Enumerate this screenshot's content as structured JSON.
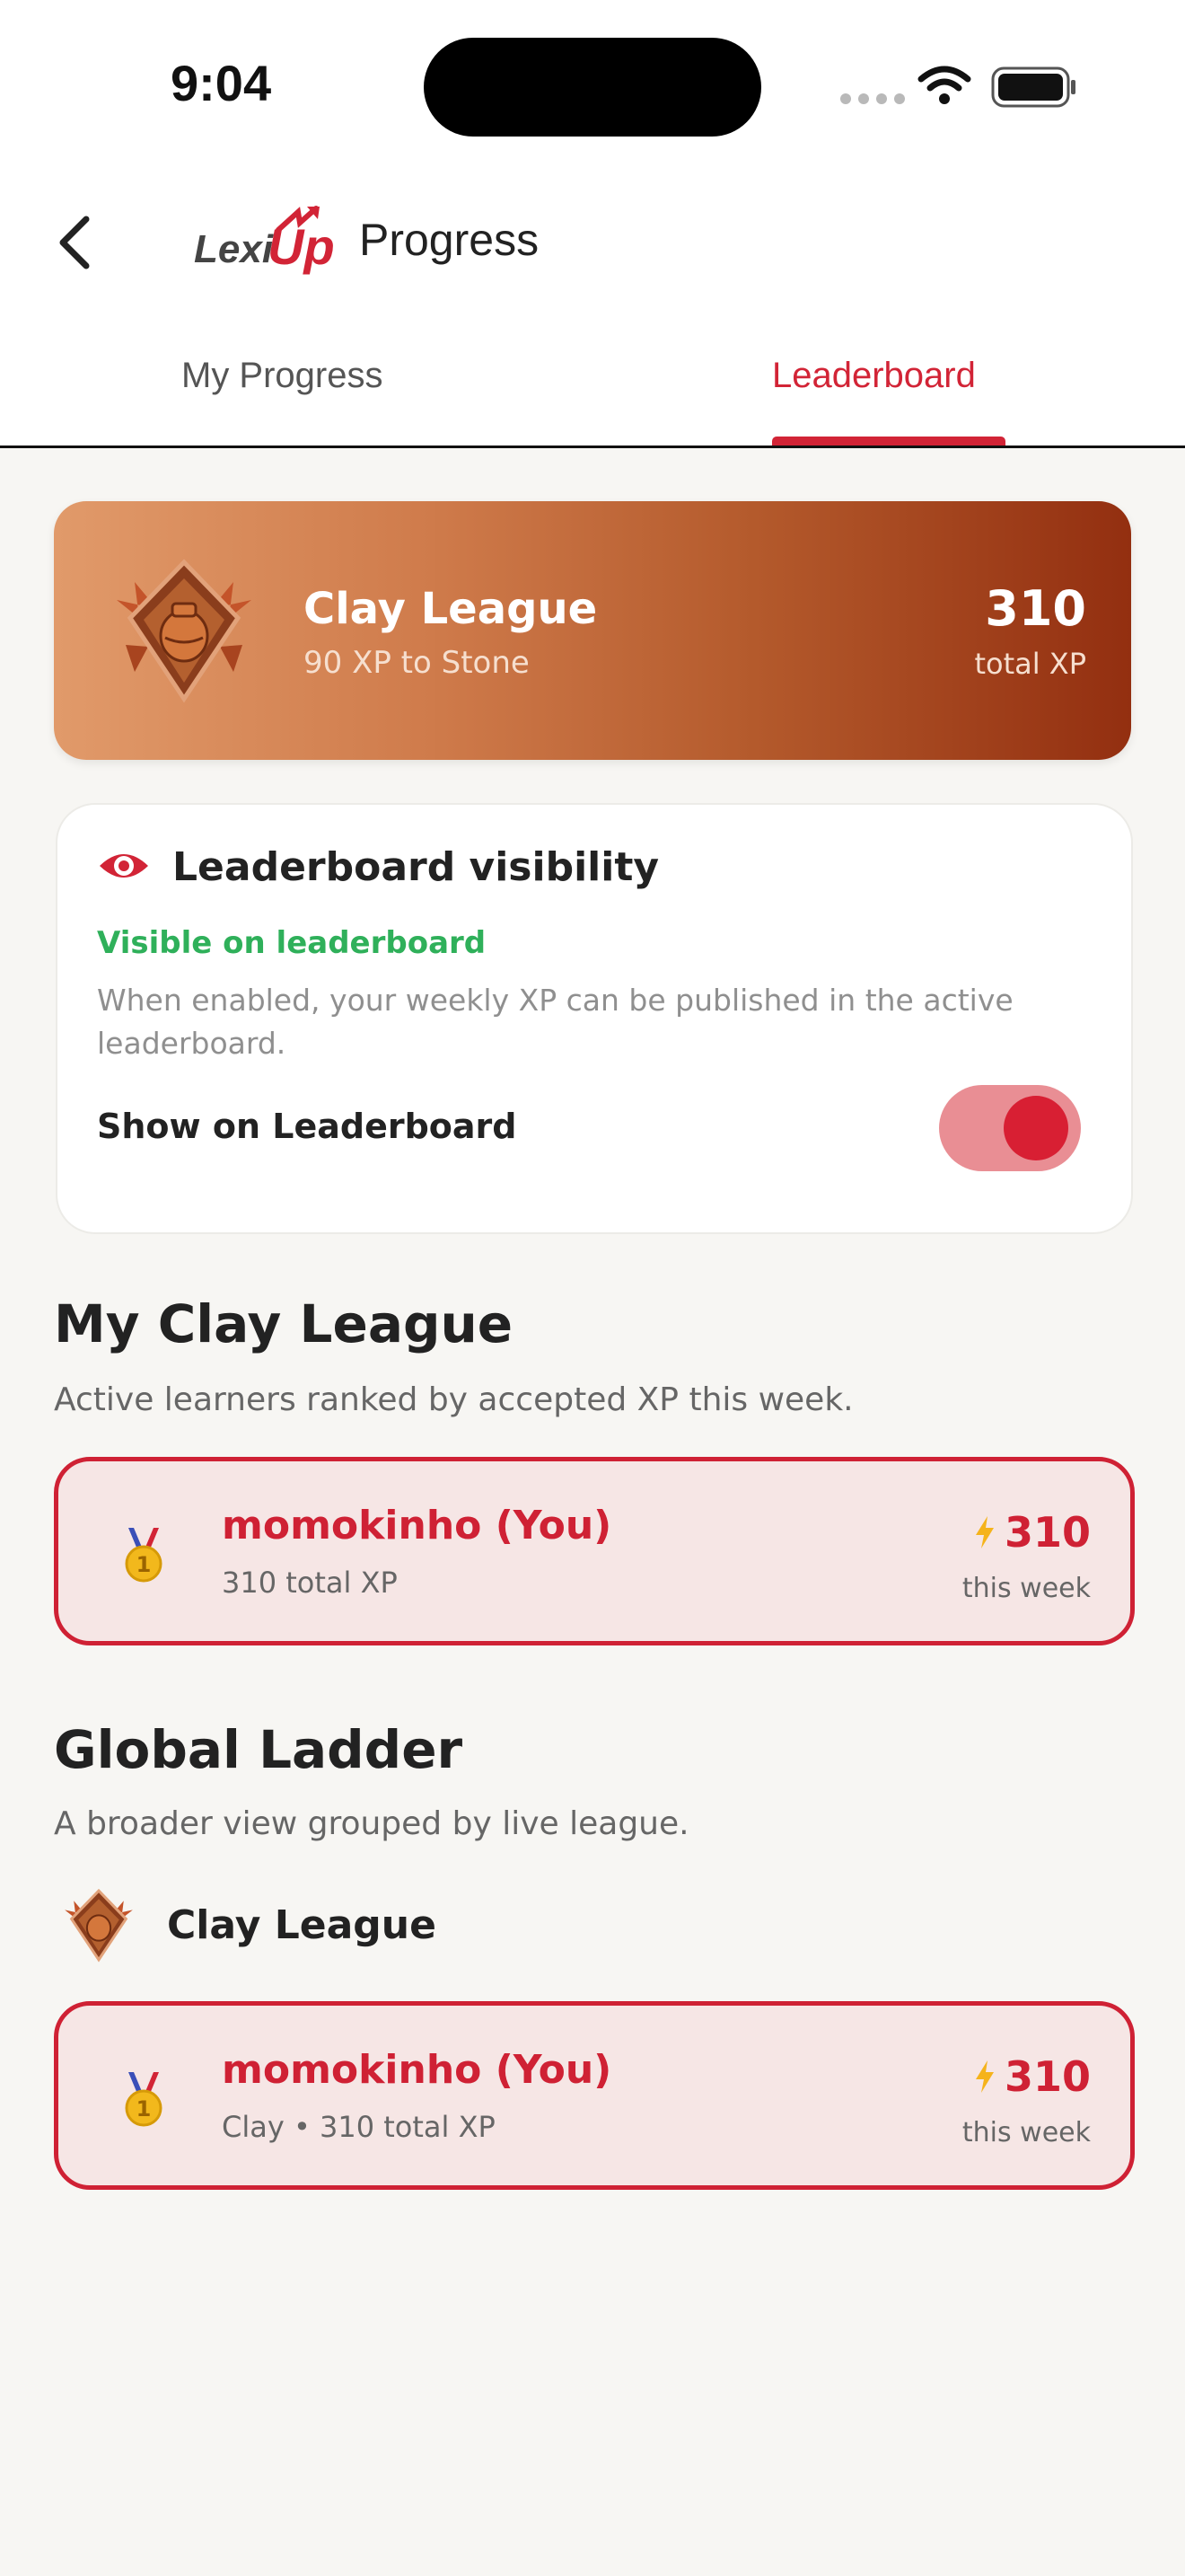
{
  "status_bar": {
    "time": "9:04"
  },
  "header": {
    "logo_text": "LexiUp",
    "title": "Progress"
  },
  "tabs": [
    {
      "label": "My Progress",
      "active": false
    },
    {
      "label": "Leaderboard",
      "active": true
    }
  ],
  "league_card": {
    "name": "Clay League",
    "subtitle": "90 XP to Stone",
    "xp": "310",
    "xp_label": "total XP",
    "icon": "clay-league-badge-icon"
  },
  "visibility": {
    "title": "Leaderboard visibility",
    "status": "Visible on leaderboard",
    "description": "When enabled, your weekly XP can be published in the active leaderboard.",
    "toggle_label": "Show on Leaderboard",
    "toggle_on": true
  },
  "my_league": {
    "title": "My Clay League",
    "subtitle": "Active learners ranked by accepted XP this week.",
    "entries": [
      {
        "name": "momokinho (You)",
        "meta": "310 total XP",
        "xp": "310",
        "xp_label": "this week",
        "rank": 1
      }
    ]
  },
  "global_ladder": {
    "title": "Global Ladder",
    "subtitle": "A broader view grouped by live league.",
    "group_label": "Clay League",
    "entries": [
      {
        "name": "momokinho (You)",
        "meta": "Clay • 310 total XP",
        "xp": "310",
        "xp_label": "this week",
        "rank": 1
      }
    ]
  },
  "colors": {
    "accent": "#d22436",
    "success": "#2fb05a",
    "clay": "#b45a2c"
  }
}
